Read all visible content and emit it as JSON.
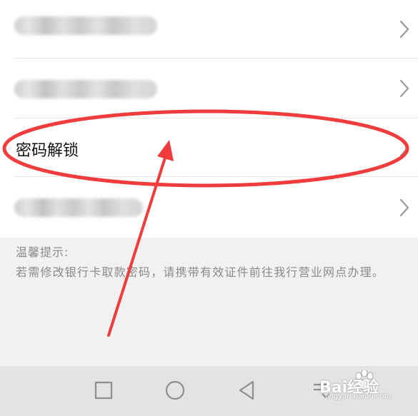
{
  "menu": {
    "items": [
      {
        "label": "",
        "obscured": true
      },
      {
        "label": "",
        "obscured": true
      },
      {
        "label": "密码解锁",
        "obscured": false
      },
      {
        "label": "",
        "obscured": true
      }
    ]
  },
  "hint": {
    "title": "温馨提示:",
    "text": "若需修改银行卡取款密码，请携带有效证件前往我行营业网点办理。"
  },
  "navbar": {
    "buttons": [
      "recent-apps-icon",
      "home-icon",
      "back-icon",
      "notification-icon"
    ]
  },
  "annotation": {
    "color": "#f03c3c"
  },
  "watermark": {
    "text": "Bai经验",
    "sub": "jingyan.baidu.com"
  }
}
